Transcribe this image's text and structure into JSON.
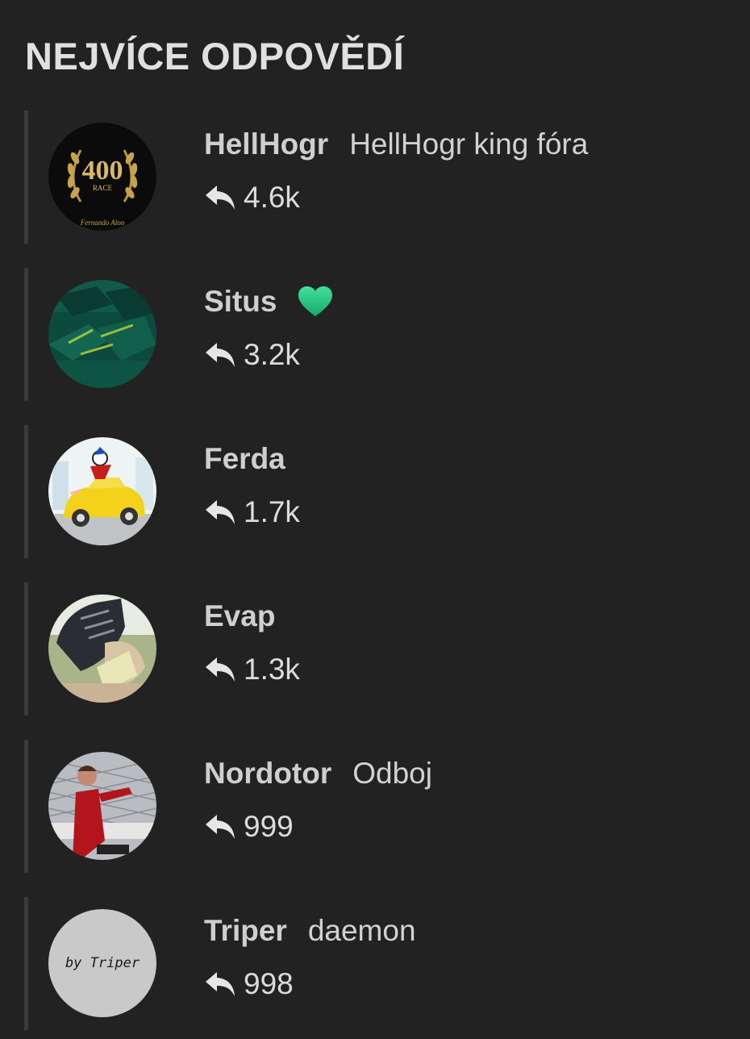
{
  "heading": "NEJVÍCE ODPOVĚDÍ",
  "users": [
    {
      "name": "HellHogr",
      "title": "HellHogr king fóra",
      "replies": "4.6k",
      "avatar_icon": "laurel-400-race-icon",
      "avatar_text": "400",
      "avatar_sub": "RACE",
      "avatar_caption": "Fernando Alon"
    },
    {
      "name": "Situs",
      "title": "",
      "replies": "3.2k",
      "avatar_icon": "green-fabric-icon",
      "badge_icon": "green-heart-icon"
    },
    {
      "name": "Ferda",
      "title": "",
      "replies": "1.7k",
      "avatar_icon": "cartoon-car-icon"
    },
    {
      "name": "Evap",
      "title": "",
      "replies": "1.3k",
      "avatar_icon": "sneaker-photo-icon"
    },
    {
      "name": "Nordotor",
      "title": "Odboj",
      "replies": "999",
      "avatar_icon": "driver-photo-icon"
    },
    {
      "name": "Triper",
      "title": "daemon",
      "replies": "998",
      "avatar_icon": "triper-signature-icon",
      "avatar_text": "by Triper"
    }
  ],
  "colors": {
    "background": "#222222",
    "row_border": "#3a3a3a",
    "heart": "#2ed37f"
  }
}
